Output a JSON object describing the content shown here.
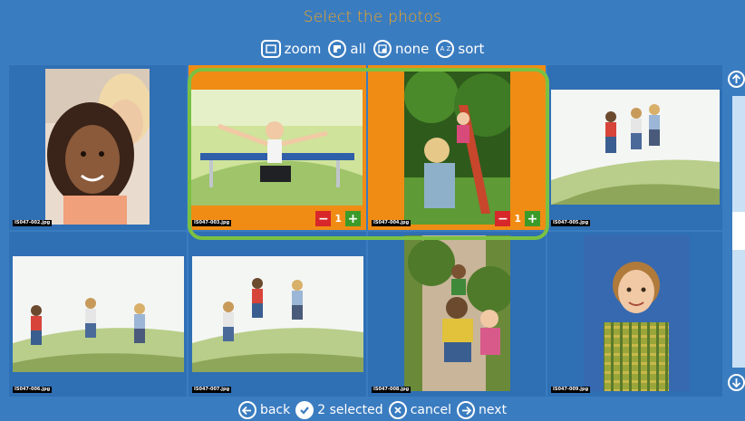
{
  "header": {
    "title": "Select the photos"
  },
  "toolbar": {
    "zoom_label": "zoom",
    "all_label": "all",
    "none_label": "none",
    "sort_label": "sort",
    "sort_icon_text": "A Z"
  },
  "photos": [
    {
      "filename": "IS047-002.jpg",
      "selected": false
    },
    {
      "filename": "IS047-003.jpg",
      "selected": true,
      "quantity": "1"
    },
    {
      "filename": "IS047-004.jpg",
      "selected": true,
      "quantity": "1"
    },
    {
      "filename": "IS047-005.jpg",
      "selected": false
    },
    {
      "filename": "IS047-006.jpg",
      "selected": false
    },
    {
      "filename": "IS047-007.jpg",
      "selected": false
    },
    {
      "filename": "IS047-008.jpg",
      "selected": false
    },
    {
      "filename": "IS047-009.jpg",
      "selected": false
    }
  ],
  "qty_minus": "−",
  "qty_plus": "+",
  "footer": {
    "back_label": "back",
    "selected_label": "2 selected",
    "cancel_label": "cancel",
    "next_label": "next"
  },
  "colors": {
    "background": "#3a7cc0",
    "title": "#f3a51f",
    "selected_cell": "#f08c13",
    "selection_frame": "#7ac143",
    "minus": "#d7272a",
    "plus": "#3b9b2a"
  }
}
